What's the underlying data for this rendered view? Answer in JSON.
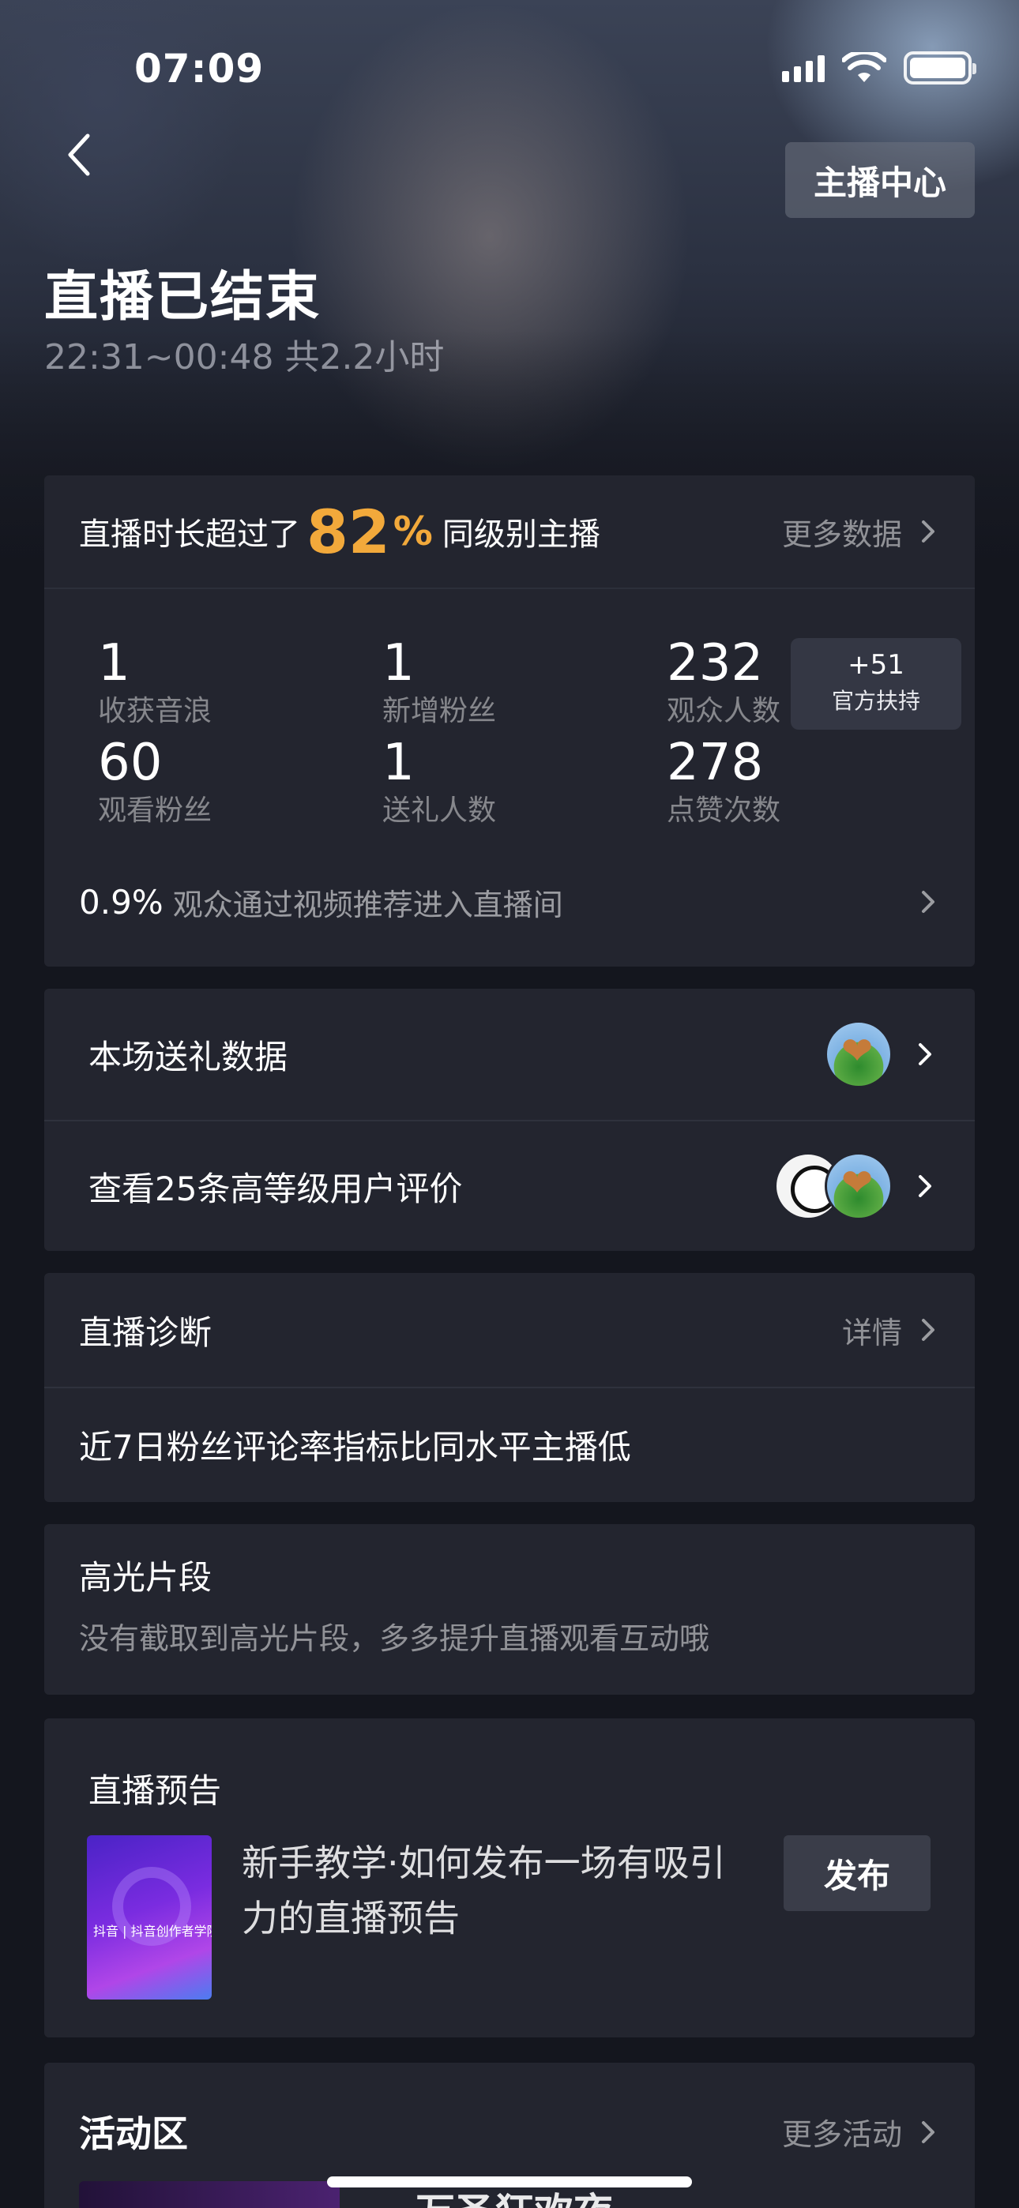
{
  "status_bar": {
    "time": "07:09"
  },
  "header": {
    "anchor_center_label": "主播中心",
    "title": "直播已结束",
    "time_range": "22:31~00:48 共2.2小时"
  },
  "stats": {
    "headline_prefix": "直播时长超过了",
    "headline_percent": "82",
    "headline_percent_sign": "%",
    "headline_suffix": "同级别主播",
    "more_label": "更多数据",
    "metrics": [
      {
        "value": "1",
        "label": "收获音浪"
      },
      {
        "value": "1",
        "label": "新增粉丝"
      },
      {
        "value": "232",
        "label": "观众人数"
      },
      {
        "value": "60",
        "label": "观看粉丝"
      },
      {
        "value": "1",
        "label": "送礼人数"
      },
      {
        "value": "278",
        "label": "点赞次数"
      }
    ],
    "boost": {
      "value": "+51",
      "label": "官方扶持"
    },
    "footer_percent": "0.9%",
    "footer_text": "观众通过视频推荐进入直播间"
  },
  "gifts": {
    "gift_data_label": "本场送礼数据",
    "reviews_label": "查看25条高等级用户评价"
  },
  "diagnosis": {
    "title": "直播诊断",
    "detail_label": "详情",
    "message": "近7日粉丝评论率指标比同水平主播低"
  },
  "highlights": {
    "title": "高光片段",
    "message": "没有截取到高光片段，多多提升直播观看互动哦"
  },
  "preview": {
    "title": "直播预告",
    "thumb_caption": "抖音 | 抖音创作者学院",
    "description": "新手教学·如何发布一场有吸引力的直播预告",
    "publish_label": "发布"
  },
  "activity": {
    "title": "活动区",
    "more_label": "更多活动",
    "item_title": "万圣狂欢夜"
  },
  "icons": {
    "back": "back-arrow-icon",
    "chevron": "chevron-right-icon",
    "signal": "cellular-signal-icon",
    "wifi": "wifi-icon",
    "battery": "battery-icon"
  },
  "colors": {
    "accent_percent": "#f2a93b",
    "card_bg": "#23252f",
    "page_bg": "#14161e"
  }
}
